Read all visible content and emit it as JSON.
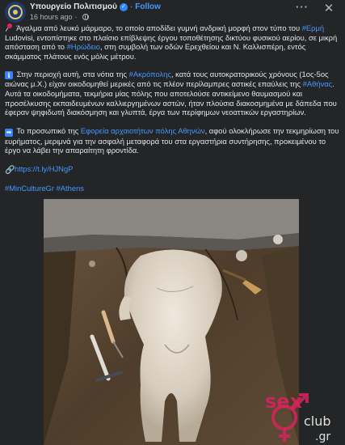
{
  "header": {
    "page_name": "Υπουργείο Πολιτισμού",
    "verified_icon": "verified-badge-icon",
    "separator": "·",
    "follow_label": "Follow",
    "timestamp": "16 hours ago",
    "timestamp_sep": "·",
    "more_label": "···",
    "close_label": "✕"
  },
  "post": {
    "p1": {
      "icon": "pushpin-icon",
      "t1": " Άγαλμα από λευκό μάρμαρο, το οποίο αποδίδει γυμνή ανδρική μορφή στον τύπο του ",
      "tag1": "#Ερμή",
      "t2": " Ludovisi, εντοπίστηκε  στο πλαίσιο επίβλεψης έργου τοποθέτησης δικτύου φυσικού αερίου, σε μικρή απόσταση από το ",
      "tag2": "#Ηρώδειο",
      "t3": ", στη συμβολή των οδών Ερεχθείου και Ν. Καλλισπέρη, εντός σκάμματος πλάτους ενός μόλις μέτρου."
    },
    "p2": {
      "icon": "info-icon",
      "t1": " Στην περιοχή αυτή, στα νότια της ",
      "tag1": "#Ακρόπολης",
      "t2": ", κατά τους αυτοκρατορικούς χρόνους (1ος-5ος αιώνας μ.Χ.) είχαν οικοδομηθεί μερικές από τις πλέον περίλαμπρες αστικές επαύλεις της ",
      "tag2": "#Αθήνας",
      "t3": ". Αυτά τα οικοδομήματα, τεκμήρια μίας πόλης που αποτελούσε αντικείμενο θαυμασμού και προσέλκυσης εκπαιδευμένων καλλιεργημένων αστών, ήταν πλούσια διακοσμημένα με δάπεδα που έφεραν ψηφιδωτή διακόσμηση και γλυπτά, έργα των περίφημων νεοαττικών εργαστηρίων."
    },
    "p3": {
      "icon": "right-arrow-icon",
      "t1": " Το προσωπικό της ",
      "tag1": "Εφορεία αρχαιοτήτων πόλης Αθηνών",
      "t2": ", αφού ολοκλήρωσε την τεκμηρίωση του ευρήματος, μεριμνά για την ασφαλή μεταφορά του στα εργαστήρια συντήρησης, προκειμένου το έργο να λάβει την απαραίτητη φροντίδα."
    },
    "p4": {
      "icon": "link-icon",
      "link": "https://t.ly/HJNgP"
    },
    "p5": {
      "tag1": "#MinCultureGr",
      "tag2": "#Athens"
    }
  },
  "photo": {
    "description_icon": "excavation-photo"
  },
  "watermark": {
    "line1": "sex",
    "line2": "club",
    "line3": ".gr"
  },
  "colors": {
    "background": "#242526",
    "text": "#e4e6eb",
    "secondary_text": "#b0b3b8",
    "link": "#4599ff",
    "watermark": "#d6245c"
  }
}
